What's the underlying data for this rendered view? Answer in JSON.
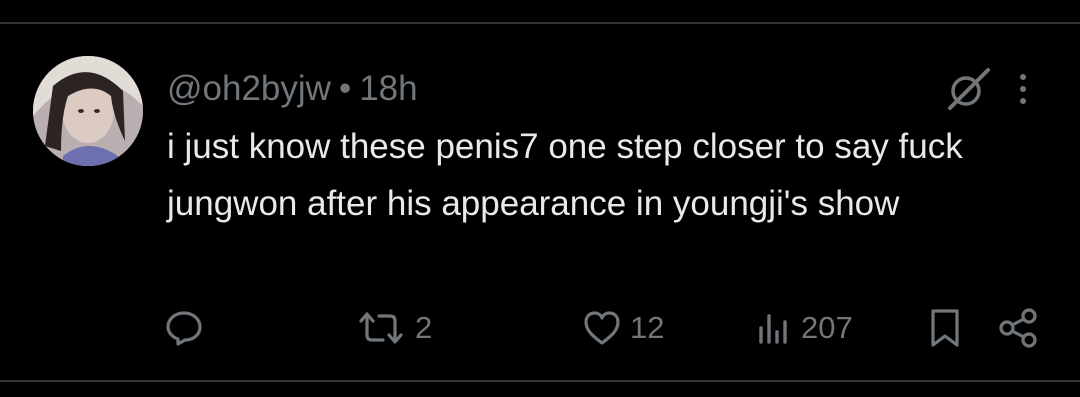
{
  "tweet": {
    "handle": "@oh2byjw",
    "separator": "•",
    "time": "18h",
    "text": "i just know these penis7 one step closer to say fuck jungwon after his appearance in youngji's show"
  },
  "actions": {
    "reply_count": "",
    "retweet_count": "2",
    "like_count": "12",
    "view_count": "207"
  },
  "icons": [
    "reply-icon",
    "retweet-icon",
    "heart-icon",
    "views-icon",
    "bookmark-icon",
    "share-icon",
    "grok-icon",
    "more-icon"
  ],
  "colors": {
    "background": "#000000",
    "text": "#e7e9ea",
    "muted": "#71767b",
    "divider": "#2f3336"
  }
}
